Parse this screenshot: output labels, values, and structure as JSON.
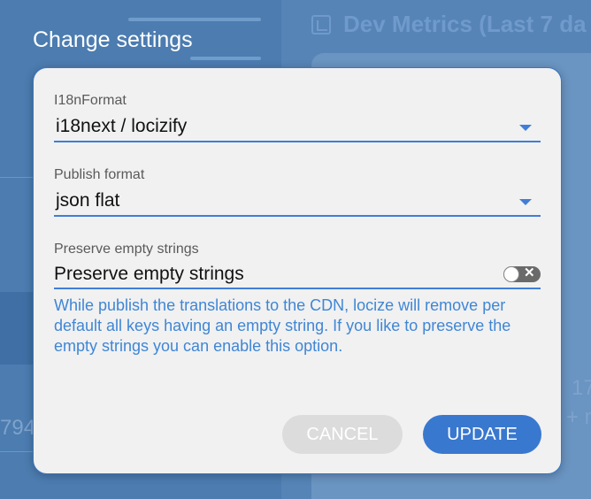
{
  "background": {
    "title": "Dev Metrics (Last 7 da",
    "snippets": [
      "794",
      "17",
      "+ m"
    ]
  },
  "dialog": {
    "title": "Change settings",
    "i18n_format": {
      "label": "I18nFormat",
      "value": "i18next / locizify"
    },
    "publish_format": {
      "label": "Publish format",
      "value": "json flat"
    },
    "preserve_empty": {
      "label": "Preserve empty strings",
      "toggle_text": "Preserve empty strings",
      "toggle_glyph": "✕",
      "checked": false,
      "helper": "While publish the translations to the CDN, locize will remove per default all keys having an empty string. If you like to preserve the empty strings you can enable this option."
    },
    "buttons": {
      "cancel": "CANCEL",
      "update": "UPDATE"
    }
  },
  "colors": {
    "accent": "#3978cf",
    "overlay": "#4f7fb3",
    "helper_text": "#3f86d6"
  }
}
